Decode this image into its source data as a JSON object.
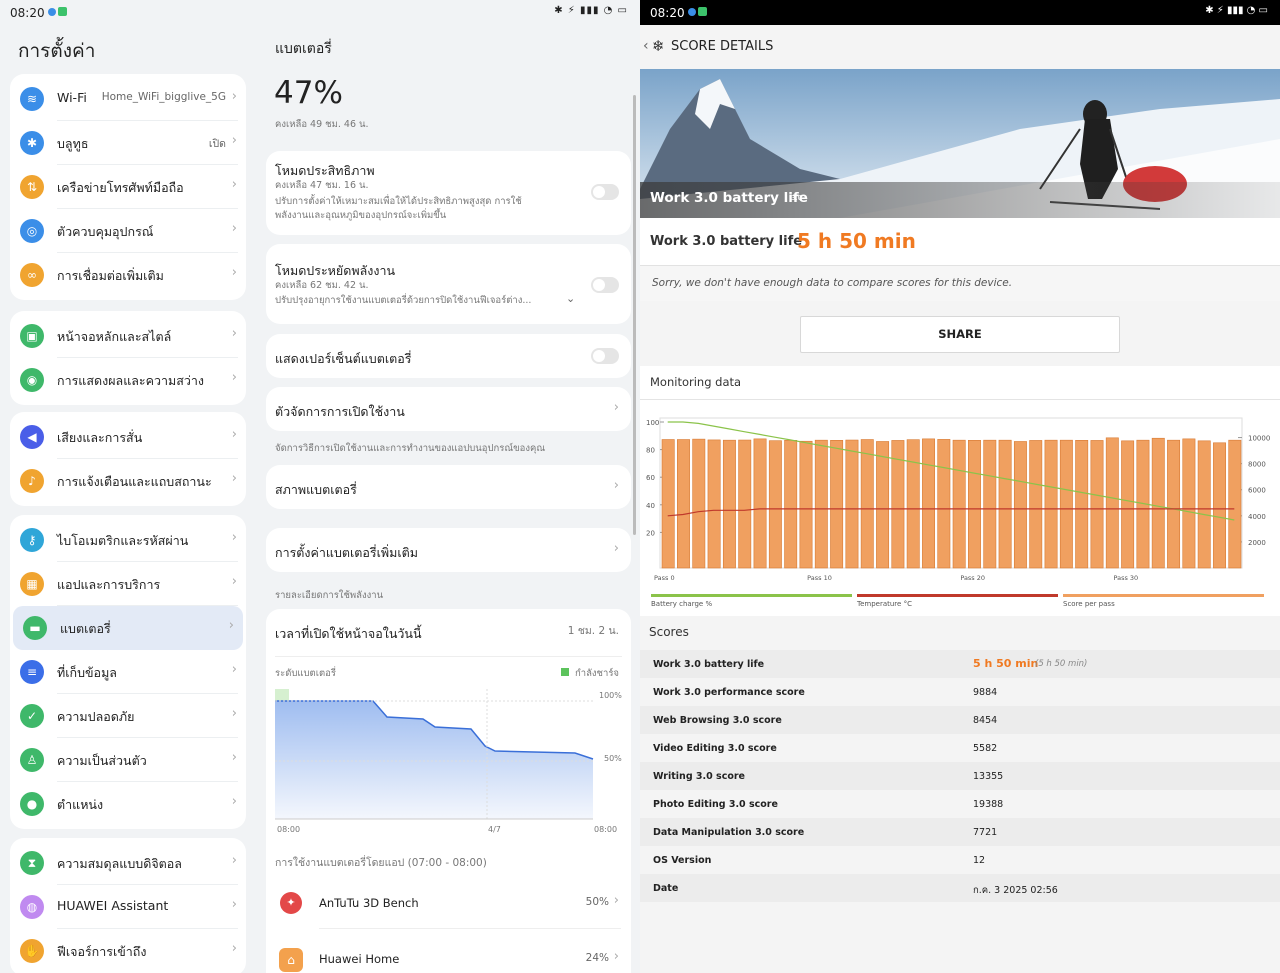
{
  "left": {
    "status_time": "08:20",
    "title": "การตั้งค่า",
    "groups": [
      [
        {
          "label": "Wi-Fi",
          "value": "Home_WiFi_bigglive_5G",
          "icon": "wifi-icon",
          "color": "#3b8ee8",
          "glyph": "≋"
        },
        {
          "label": "บลูทูธ",
          "value": "เปิด",
          "icon": "bluetooth-icon",
          "color": "#3b8ee8",
          "glyph": "✱"
        },
        {
          "label": "เครือข่ายโทรศัพท์มือถือ",
          "value": "",
          "icon": "cellular-icon",
          "color": "#f0a430",
          "glyph": "⇅"
        },
        {
          "label": "ตัวควบคุมอุปกรณ์",
          "value": "",
          "icon": "device-control-icon",
          "color": "#3b8ee8",
          "glyph": "◎"
        },
        {
          "label": "การเชื่อมต่อเพิ่มเติม",
          "value": "",
          "icon": "link-icon",
          "color": "#f0a430",
          "glyph": "∞"
        }
      ],
      [
        {
          "label": "หน้าจอหลักและสไตล์",
          "value": "",
          "icon": "home-screen-icon",
          "color": "#3fb86a",
          "glyph": "▣"
        },
        {
          "label": "การแสดงผลและความสว่าง",
          "value": "",
          "icon": "display-icon",
          "color": "#3fb86a",
          "glyph": "◉"
        }
      ],
      [
        {
          "label": "เสียงและการสั่น",
          "value": "",
          "icon": "sound-icon",
          "color": "#4a5ee8",
          "glyph": "◀"
        },
        {
          "label": "การแจ้งเตือนและแถบสถานะ",
          "value": "",
          "icon": "notification-icon",
          "color": "#f0a430",
          "glyph": "♪"
        }
      ],
      [
        {
          "label": "ไบโอเมตริกและรหัสผ่าน",
          "value": "",
          "icon": "key-icon",
          "color": "#2fa6d8",
          "glyph": "⚷"
        },
        {
          "label": "แอปและการบริการ",
          "value": "",
          "icon": "apps-icon",
          "color": "#f0a430",
          "glyph": "▦"
        },
        {
          "label": "แบตเตอรี่",
          "value": "",
          "icon": "battery-icon",
          "color": "#3fb86a",
          "glyph": "▬"
        },
        {
          "label": "ที่เก็บข้อมูล",
          "value": "",
          "icon": "storage-icon",
          "color": "#3b6ee8",
          "glyph": "≡"
        },
        {
          "label": "ความปลอดภัย",
          "value": "",
          "icon": "security-icon",
          "color": "#3fb86a",
          "glyph": "✓"
        },
        {
          "label": "ความเป็นส่วนตัว",
          "value": "",
          "icon": "privacy-icon",
          "color": "#3fb86a",
          "glyph": "♙"
        },
        {
          "label": "ตำแหน่ง",
          "value": "",
          "icon": "location-icon",
          "color": "#3fb86a",
          "glyph": "●"
        }
      ],
      [
        {
          "label": "ความสมดุลแบบดิจิตอล",
          "value": "",
          "icon": "digital-balance-icon",
          "color": "#3fb86a",
          "glyph": "⧗"
        },
        {
          "label": "HUAWEI Assistant",
          "value": "",
          "icon": "assistant-icon",
          "color": "#c08af0",
          "glyph": "◍"
        },
        {
          "label": "ฟีเจอร์การเข้าถึง",
          "value": "",
          "icon": "accessibility-icon",
          "color": "#f0a430",
          "glyph": "✋"
        }
      ]
    ]
  },
  "battery": {
    "title": "แบตเตอรี่",
    "percent": "47%",
    "remaining": "คงเหลือ 49 ชม. 46 น.",
    "perf_title": "โหมดประสิทธิภาพ",
    "perf_time": "คงเหลือ 47 ชม. 16 น.",
    "perf_desc1": "ปรับการตั้งค่าให้เหมาะสมเพื่อให้ได้ประสิทธิภาพสูงสุด การใช้",
    "perf_desc2": "พลังงานและอุณหภูมิของอุปกรณ์จะเพิ่มขึ้น",
    "save_title": "โหมดประหยัดพลังงาน",
    "save_time": "คงเหลือ 62 ชม. 42 น.",
    "save_desc": "ปรับปรุงอายุการใช้งานแบตเตอรี่ด้วยการปิดใช้งานฟีเจอร์ต่าง...",
    "show_pct": "แสดงเปอร์เซ็นต์แบตเตอรี่",
    "launch": "ตัวจัดการการเปิดใช้งาน",
    "launch_desc": "จัดการวิธีการเปิดใช้งานและการทำงานของแอปบนอุปกรณ์ของคุณ",
    "status": "สภาพแบตเตอรี่",
    "more": "การตั้งค่าแบตเตอรี่เพิ่มเติม",
    "usage_hdr": "รายละเอียดการใช้พลังงาน",
    "screen_on": "เวลาที่เปิดใช้หน้าจอในวันนี้",
    "screen_on_val": "1 ชม. 2 น.",
    "level": "ระดับแบตเตอรี่",
    "charging": "กำลังชาร์จ",
    "y100": "100%",
    "y50": "50%",
    "x0": "08:00",
    "x1": "4/7",
    "x2": "08:00",
    "by_app": "การใช้งานแบตเตอรี่โดยแอป (07:00 - 08:00)",
    "apps": [
      {
        "name": "AnTuTu 3D Bench",
        "pct": "50%"
      },
      {
        "name": "Huawei Home",
        "pct": "24%"
      }
    ]
  },
  "right": {
    "status_time": "08:20",
    "header": "SCORE DETAILS",
    "hero_caption": "Work 3.0 battery life",
    "hero_ver": "3.0",
    "score_label": "Work 3.0 battery life",
    "score_value": "5 h 50 min",
    "compare": "Sorry, we don't have enough data to compare scores for this device.",
    "share": "SHARE",
    "monitoring": "Monitoring data",
    "scores_hdr": "Scores",
    "legend": [
      "Battery charge %",
      "Temperature °C",
      "Score per pass"
    ],
    "rows": [
      {
        "name": "Work 3.0 battery life",
        "value": "5 h 50 min",
        "sub": "(5 h 50 min)"
      },
      {
        "name": "Work 3.0 performance score",
        "value": "9884"
      },
      {
        "name": "Web Browsing 3.0 score",
        "value": "8454"
      },
      {
        "name": "Video Editing 3.0 score",
        "value": "5582"
      },
      {
        "name": "Writing 3.0 score",
        "value": "13355"
      },
      {
        "name": "Photo Editing 3.0 score",
        "value": "19388"
      },
      {
        "name": "Data Manipulation 3.0 score",
        "value": "7721"
      },
      {
        "name": "OS Version",
        "value": "12"
      },
      {
        "name": "Date",
        "value": "ก.ค. 3 2025 02:56"
      }
    ]
  },
  "chart_data": {
    "type": "bar",
    "title": "Monitoring data",
    "yleft": {
      "ticks": [
        "100",
        "80",
        "60",
        "40",
        "20"
      ],
      "lim": [
        0,
        100
      ]
    },
    "yright": {
      "ticks": [
        "10000",
        "8000",
        "6000",
        "4000",
        "2000"
      ],
      "lim": [
        0,
        11500
      ]
    },
    "xticks": [
      "Pass 0",
      "Pass 10",
      "Pass 20",
      "Pass 30"
    ],
    "series": [
      {
        "name": "Score per pass",
        "color": "#f0a060",
        "values": [
          9850,
          9850,
          9880,
          9820,
          9800,
          9810,
          9900,
          9760,
          9790,
          9720,
          9800,
          9790,
          9810,
          9850,
          9700,
          9780,
          9840,
          9900,
          9860,
          9800,
          9790,
          9800,
          9800,
          9700,
          9780,
          9800,
          9800,
          9790,
          9780,
          9980,
          9750,
          9800,
          9950,
          9800,
          9900,
          9750,
          9600,
          9800
        ]
      },
      {
        "name": "Battery charge %",
        "color": "#8bc34a",
        "values": [
          100,
          100,
          99,
          97,
          95,
          93,
          91,
          89,
          87,
          85,
          83,
          81,
          79,
          77,
          75,
          73,
          71,
          69,
          67,
          65,
          63,
          61,
          59,
          57,
          55,
          53,
          51,
          49,
          47,
          45,
          43,
          41,
          39,
          37,
          35,
          33,
          31,
          29
        ]
      },
      {
        "name": "Temperature °C",
        "color": "#c0392b",
        "values": [
          32,
          33,
          35,
          36,
          36,
          36,
          37,
          37,
          37,
          37,
          37,
          37,
          37,
          37,
          37,
          37,
          37,
          37,
          37,
          37,
          37,
          37,
          37,
          37,
          37,
          37,
          37,
          37,
          37,
          37,
          37,
          37,
          37,
          37,
          37,
          37,
          37,
          37
        ]
      }
    ]
  }
}
